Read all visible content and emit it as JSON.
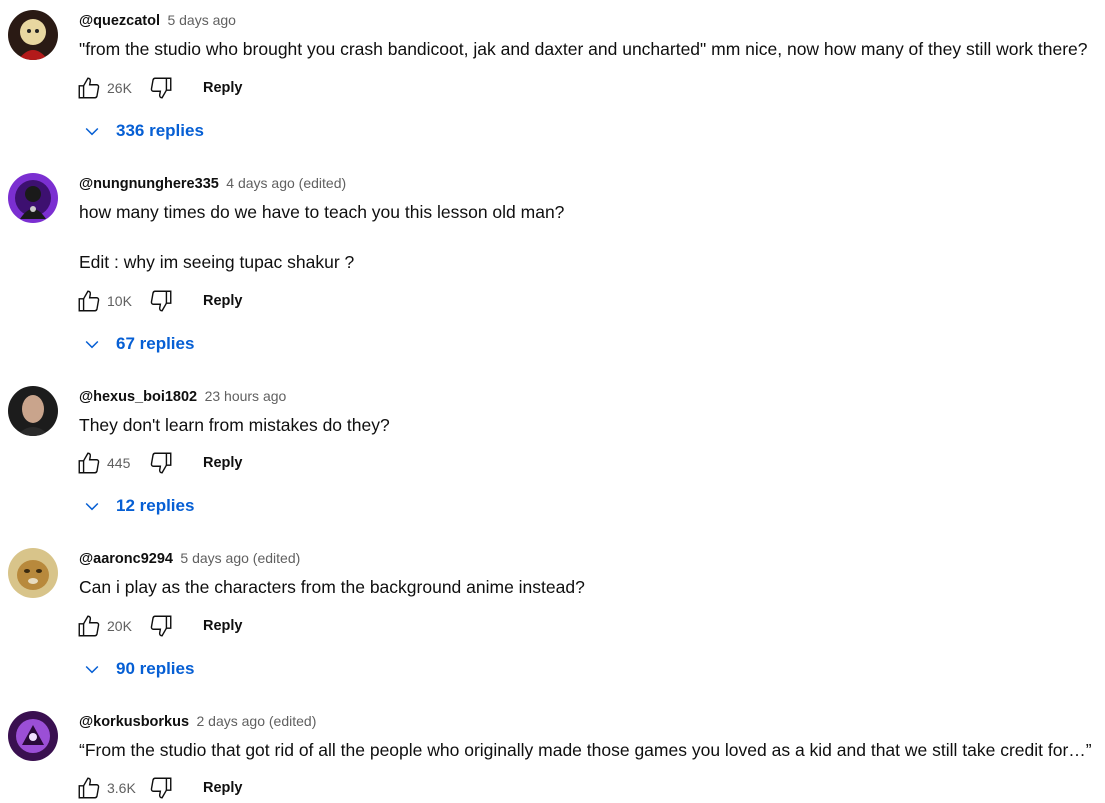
{
  "comments": [
    {
      "author": "@quezcatol",
      "time": "5 days ago",
      "lines": [
        "\"from the studio who brought you crash bandicoot, jak and daxter and uncharted\" mm nice, now how many of they still work there?"
      ],
      "likes": "26K",
      "reply_label": "Reply",
      "replies_label": "336 replies"
    },
    {
      "author": "@nungnunghere335",
      "time": "4 days ago (edited)",
      "lines": [
        "how many times do we have to teach you this lesson old man?",
        "Edit : why im seeing tupac shakur ?"
      ],
      "likes": "10K",
      "reply_label": "Reply",
      "replies_label": "67 replies"
    },
    {
      "author": "@hexus_boi1802",
      "time": "23 hours ago",
      "lines": [
        "They don't learn from mistakes do they?"
      ],
      "likes": "445",
      "reply_label": "Reply",
      "replies_label": "12 replies"
    },
    {
      "author": "@aaronc9294",
      "time": "5 days ago (edited)",
      "lines": [
        "Can i play as the characters from the background anime instead?"
      ],
      "likes": "20K",
      "reply_label": "Reply",
      "replies_label": "90 replies"
    },
    {
      "author": "@korkusborkus",
      "time": "2 days ago (edited)",
      "lines": [
        "“From the studio that got rid of all the people who originally made those games you loved as a kid and that we still take credit for…”"
      ],
      "likes": "3.6K",
      "reply_label": "Reply"
    }
  ],
  "icons": {
    "like": "thumbs-up-icon",
    "dislike": "thumbs-down-icon",
    "expand": "chevron-down-icon"
  },
  "colors": {
    "link_blue": "#065fd4",
    "secondary_text": "#606060",
    "primary_text": "#0f0f0f"
  }
}
